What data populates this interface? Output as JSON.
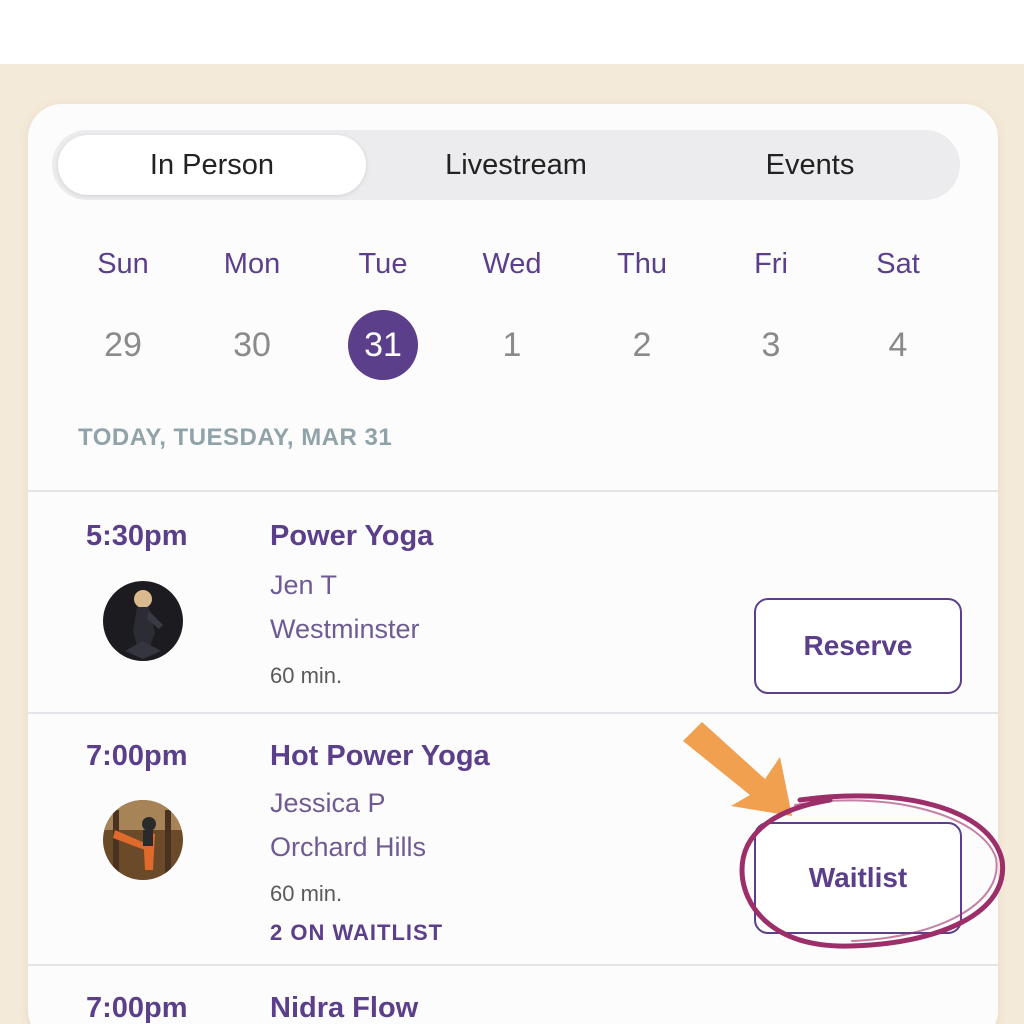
{
  "tabs": [
    {
      "label": "In Person",
      "active": true
    },
    {
      "label": "Livestream",
      "active": false
    },
    {
      "label": "Events",
      "active": false
    }
  ],
  "week": [
    {
      "day": "Sun",
      "date": "29"
    },
    {
      "day": "Mon",
      "date": "30"
    },
    {
      "day": "Tue",
      "date": "31",
      "selected": true
    },
    {
      "day": "Wed",
      "date": "1"
    },
    {
      "day": "Thu",
      "date": "2"
    },
    {
      "day": "Fri",
      "date": "3"
    },
    {
      "day": "Sat",
      "date": "4"
    }
  ],
  "date_header": "TODAY, TUESDAY, MAR 31",
  "classes": [
    {
      "time": "5:30pm",
      "title": "Power Yoga",
      "instructor": "Jen T",
      "location": "Westminster",
      "duration": "60 min.",
      "action": "Reserve"
    },
    {
      "time": "7:00pm",
      "title": "Hot Power Yoga",
      "instructor": "Jessica P",
      "location": "Orchard Hills",
      "duration": "60 min.",
      "waitlist": "2 ON WAITLIST",
      "action": "Waitlist"
    },
    {
      "time": "7:00pm",
      "title": "Nidra Flow"
    }
  ],
  "colors": {
    "accent": "#5b3f8a",
    "annotation_arrow": "#f0a04e",
    "annotation_circle": "#9c2f6a",
    "page_background": "#f4ead9"
  }
}
